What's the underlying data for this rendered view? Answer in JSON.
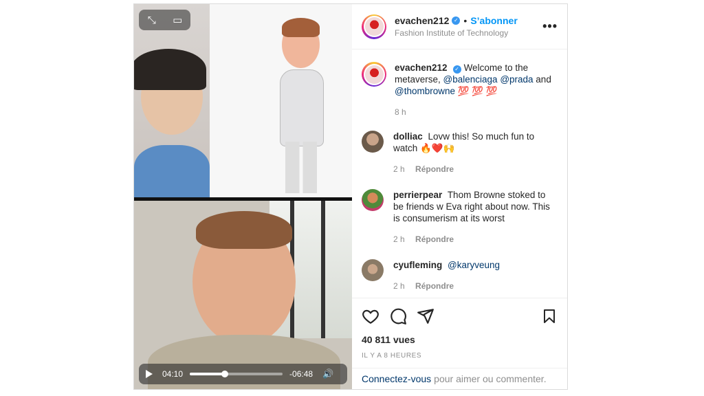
{
  "header": {
    "username": "evachen212",
    "follow_label": "S’abonner",
    "location": "Fashion Institute of Technology",
    "more_label": "•••"
  },
  "caption": {
    "username": "evachen212",
    "text_before": "Welcome to the metaverse, ",
    "mention1": "@balenciaga",
    "mention2": "@prada",
    "and_text": " and ",
    "mention3": "@thombrowne",
    "emojis": " 💯 💯 💯",
    "time": "8 h"
  },
  "comments": [
    {
      "username": "dolliac",
      "text": "Lovw this! So much fun to watch 🔥❤️🙌",
      "time": "2 h",
      "reply": "Répondre",
      "avatar_color": "#6b5a4a"
    },
    {
      "username": "perrierpear",
      "text": "Thom Browne stoked to be friends w Eva right about now. This is consumerism at its worst",
      "time": "2 h",
      "reply": "Répondre",
      "avatar_color": "#4f8a3a"
    },
    {
      "username": "cyufleming",
      "mention": "@karyveung",
      "time": "2 h",
      "reply": "Répondre",
      "avatar_color": "#8a7a66"
    }
  ],
  "stats": {
    "views": "40 811 vues",
    "posted": "IL Y A 8 HEURES"
  },
  "login": {
    "link": "Connectez-vous",
    "text": "pour aimer ou commenter."
  },
  "video": {
    "elapsed": "04:10",
    "remaining": "-06:48",
    "progress": 0.38
  },
  "colors": {
    "accent": "#0095f6",
    "mention": "#00376b",
    "muted": "#8e8e8e"
  },
  "icons": {
    "expand": "expand-icon",
    "pip": "picture-in-picture-icon",
    "play": "play-icon",
    "volume": "volume-icon",
    "like": "heart-icon",
    "comment": "comment-icon",
    "share": "share-icon",
    "save": "bookmark-icon"
  }
}
